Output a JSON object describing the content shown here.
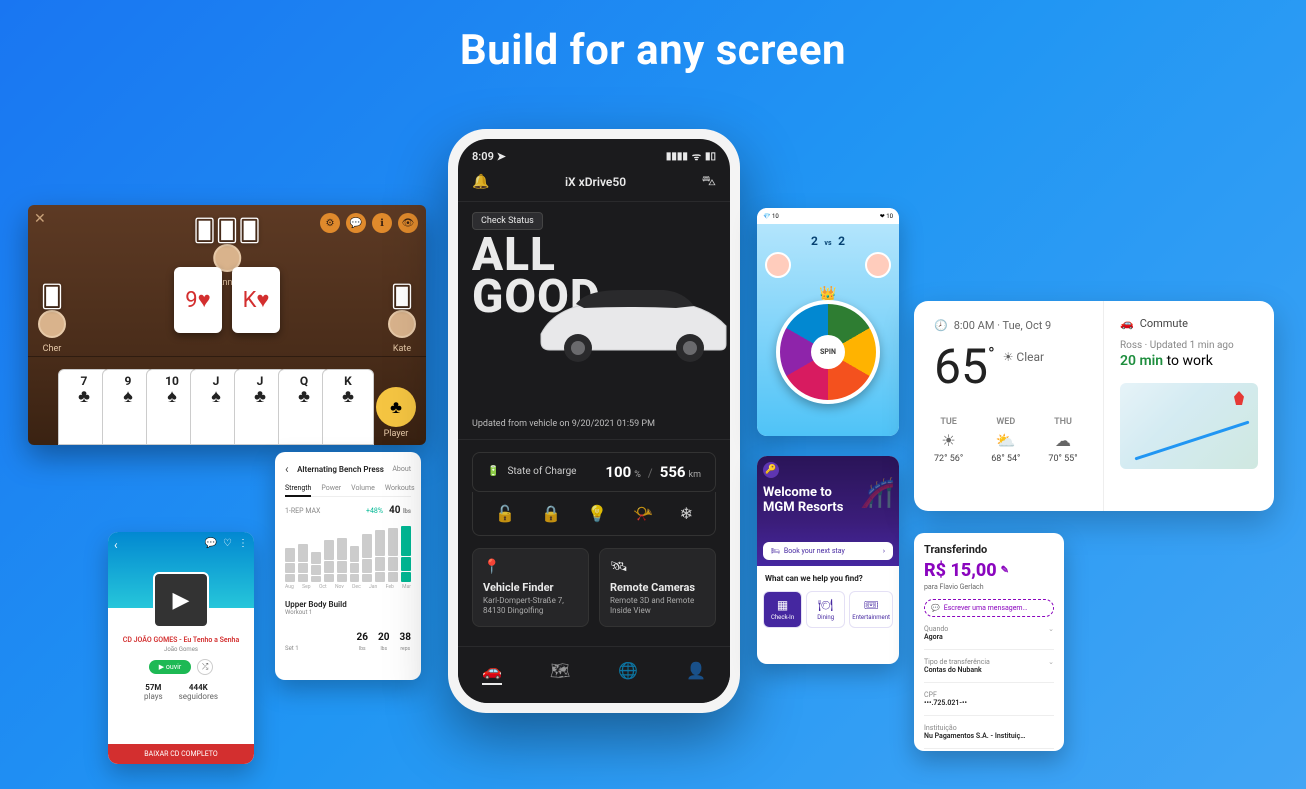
{
  "page_title": "Build for any screen",
  "card_game": {
    "top_player": "Anna",
    "left_player": "Cher",
    "right_player": "Kate",
    "me_player": "Player",
    "center_cards": [
      {
        "rank": "9",
        "suit": "♥"
      },
      {
        "rank": "K",
        "suit": "♥"
      }
    ],
    "hand": [
      {
        "rank": "7",
        "suit": "♣"
      },
      {
        "rank": "9",
        "suit": "♠"
      },
      {
        "rank": "10",
        "suit": "♠"
      },
      {
        "rank": "J",
        "suit": "♠"
      },
      {
        "rank": "J",
        "suit": "♣"
      },
      {
        "rank": "Q",
        "suit": "♣"
      },
      {
        "rank": "K",
        "suit": "♣"
      }
    ]
  },
  "music": {
    "track": "CD JOÃO GOMES - Eu Tenho a Senha",
    "artist": "João Gomes",
    "play_label": "▶  ouvir",
    "stat_a_value": "57M",
    "stat_a_label": "plays",
    "stat_b_value": "444K",
    "stat_b_label": "seguidores",
    "cta": "BAIXAR CD COMPLETO"
  },
  "workout": {
    "title": "Alternating Bench Press",
    "about": "About",
    "tabs": [
      "Strength",
      "Power",
      "Volume",
      "Workouts"
    ],
    "active_tab": 0,
    "max_label": "1-REP MAX",
    "max_delta": "+48%",
    "max_value": "40",
    "max_unit": "lbs",
    "months": [
      "Aug",
      "Sep",
      "Oct",
      "Nov",
      "Dec",
      "Jan",
      "Feb",
      "Mar"
    ],
    "lower_title": "Upper Body Build",
    "lower_sub": "Workout 1",
    "set_label": "Set 1",
    "nums": [
      {
        "v": "26",
        "l": "lbs"
      },
      {
        "v": "20",
        "l": "lbs"
      },
      {
        "v": "38",
        "l": "reps"
      }
    ]
  },
  "phone": {
    "time": "8:09",
    "model": "iX xDrive50",
    "check_status": "Check Status",
    "hero_line1": "ALL",
    "hero_line2": "GOOD",
    "updated": "Updated from vehicle on 9/20/2021 01:59 PM",
    "charge_label": "State of Charge",
    "charge_pct": "100",
    "charge_pct_unit": "%",
    "range": "556",
    "range_unit": "km",
    "card_a_title": "Vehicle Finder",
    "card_a_sub": "Karl-Dompert-Straße 7, 84130 Dingolfing",
    "card_b_title": "Remote Cameras",
    "card_b_sub": "Remote 3D and Remote Inside View"
  },
  "spin": {
    "score_left": "2",
    "vs": "vs",
    "score_right": "2",
    "hub": "SPIN"
  },
  "mgm": {
    "welcome_line1": "Welcome to",
    "welcome_line2": "MGM Resorts",
    "book": "Book your next stay",
    "help": "What can we help you find?",
    "cells": [
      {
        "icon": "▦",
        "label": "Check-In"
      },
      {
        "icon": "🍽",
        "label": "Dining"
      },
      {
        "icon": "🎟",
        "label": "Entertainment"
      }
    ]
  },
  "weather": {
    "time_label": "8:00 AM · Tue, Oct 9",
    "temp": "65",
    "cond": "Clear",
    "days": [
      {
        "name": "TUE",
        "icon": "☀",
        "hi": "72°",
        "lo": "56°"
      },
      {
        "name": "WED",
        "icon": "⛅",
        "hi": "68°",
        "lo": "54°"
      },
      {
        "name": "THU",
        "icon": "☁",
        "hi": "70°",
        "lo": "55°"
      }
    ],
    "commute_label": "Commute",
    "commute_from": "Ross",
    "commute_updated": "Updated 1 min ago",
    "commute_eta": "20 min",
    "commute_dest": "to work"
  },
  "nubank": {
    "title": "Transferindo",
    "amount": "R$ 15,00",
    "to": "para Flavio Gerlach",
    "msg": "Escrever uma mensagem…",
    "rows": [
      {
        "k": "Quando",
        "v": "Agora",
        "chev": true
      },
      {
        "k": "Tipo de transferência",
        "v": "Contas do Nubank",
        "chev": true
      },
      {
        "k": "CPF",
        "v": "•••.725.021-••",
        "chev": false
      },
      {
        "k": "Instituição",
        "v": "Nu Pagamentos S.A. - Instituiç…",
        "chev": false
      }
    ]
  }
}
